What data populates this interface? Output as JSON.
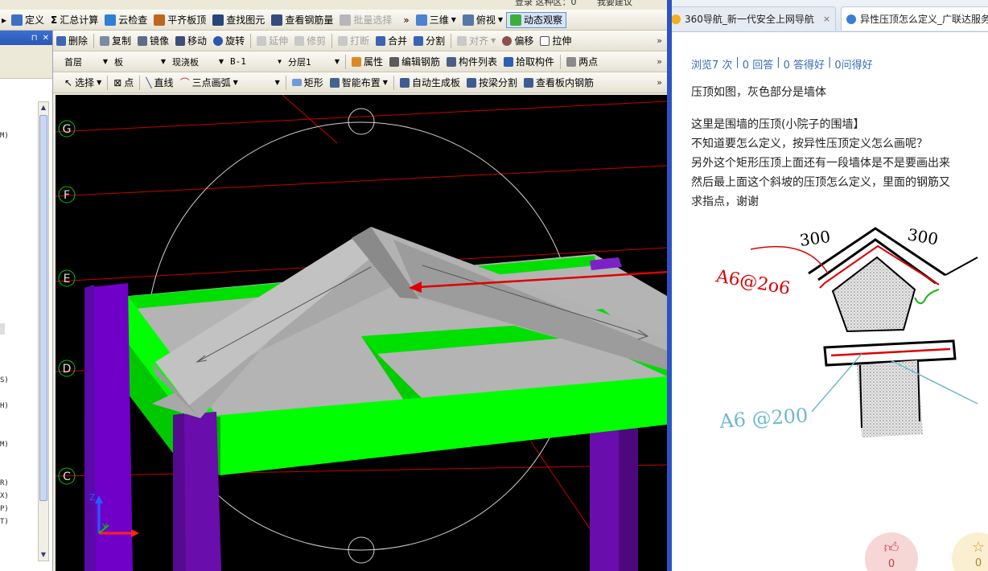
{
  "toolbar_row1": {
    "items": [
      {
        "label": "定义",
        "icon": "define-icon"
      },
      {
        "label": "汇总计算",
        "icon": "sigma-icon"
      },
      {
        "label": "云检查",
        "icon": "cloud-check-icon"
      },
      {
        "label": "平齐板顶",
        "icon": "align-slab-top-icon"
      },
      {
        "label": "查找图元",
        "icon": "find-element-icon"
      },
      {
        "label": "查看钢筋量",
        "icon": "view-rebar-icon"
      },
      {
        "label": "批量选择",
        "icon": "batch-select-icon",
        "disabled": true
      }
    ],
    "overflow": "»",
    "view_3d": "三维",
    "view_top": "俯视",
    "dynamic_view": "动态观察",
    "topright_partial": "登录 这种区：0",
    "feedback_partial": "我要建议"
  },
  "toolbar_row2": {
    "items": [
      {
        "label": "删除",
        "icon": "delete-icon"
      },
      {
        "label": "复制",
        "icon": "copy-icon"
      },
      {
        "label": "镜像",
        "icon": "mirror-icon"
      },
      {
        "label": "移动",
        "icon": "move-icon"
      },
      {
        "label": "旋转",
        "icon": "rotate-icon"
      },
      {
        "label": "延伸",
        "icon": "extend-icon",
        "disabled": true
      },
      {
        "label": "修剪",
        "icon": "trim-icon",
        "disabled": true
      },
      {
        "label": "打断",
        "icon": "break-icon",
        "disabled": true
      },
      {
        "label": "合并",
        "icon": "merge-icon"
      },
      {
        "label": "分割",
        "icon": "split-icon"
      },
      {
        "label": "对齐",
        "icon": "align-icon",
        "disabled": true
      },
      {
        "label": "偏移",
        "icon": "offset-icon"
      },
      {
        "label": "拉伸",
        "icon": "stretch-icon"
      }
    ]
  },
  "toolbar_row3": {
    "floor": "首层",
    "element_type": "板",
    "slab_type": "现浇板",
    "slab_name": "B-1",
    "layer": "分层1",
    "items": [
      {
        "label": "属性",
        "icon": "properties-icon"
      },
      {
        "label": "编辑钢筋",
        "icon": "edit-rebar-icon"
      },
      {
        "label": "构件列表",
        "icon": "component-list-icon"
      },
      {
        "label": "拾取构件",
        "icon": "pick-component-icon"
      },
      {
        "label": "两点",
        "icon": "two-point-icon"
      }
    ]
  },
  "toolbar_row4": {
    "select": "选择",
    "point": "点",
    "line": "直线",
    "arc": "三点画弧",
    "rect": "矩形",
    "smart_layout": "智能布置",
    "auto_slab": "自动生成板",
    "split_by_beam": "按梁分割",
    "view_slab_rebar": "查看板内钢筋"
  },
  "left_panel": {
    "labels": [
      "M)",
      "S)",
      "H)",
      "M)",
      "R)",
      "X)",
      "P)",
      "T)"
    ]
  },
  "viewport": {
    "axes": [
      "G",
      "F",
      "E",
      "D",
      "C"
    ],
    "axis_x": "X",
    "axis_y": "Y",
    "axis_z": "Z"
  },
  "browser": {
    "tabs": [
      {
        "title": "360导航_新一代安全上网导航",
        "close": "×"
      },
      {
        "title": "异性压顶怎么定义_广联达服务"
      }
    ],
    "stats": {
      "views": "浏览7 次",
      "answers": "0 回答",
      "good": "0 答得好",
      "ask_good": "0问得好"
    },
    "paragraphs": [
      "压顶如图，灰色部分是墙体",
      "这里是围墙的压顶(小院子的围墙】",
      "不知道要怎么定义，按异性压顶定义怎么画呢？",
      "另外这个矩形压顶上面还有一段墙体是不是要画出来",
      "然后最上面这个斜坡的压顶怎么定义，里面的钢筋又",
      "求指点，谢谢"
    ],
    "sketch": {
      "dim_left": "300",
      "dim_right": "300",
      "rebar_top": "A6@2o6",
      "rebar_bottom": "A6 @200"
    },
    "like_count": "0",
    "fav_count": "0"
  },
  "colors": {
    "beam": "#00ff00",
    "column": "#6a0dad",
    "slab": "#b4b4b4",
    "accent_blue": "#3b6bb5",
    "arrow": "#ff0000"
  }
}
